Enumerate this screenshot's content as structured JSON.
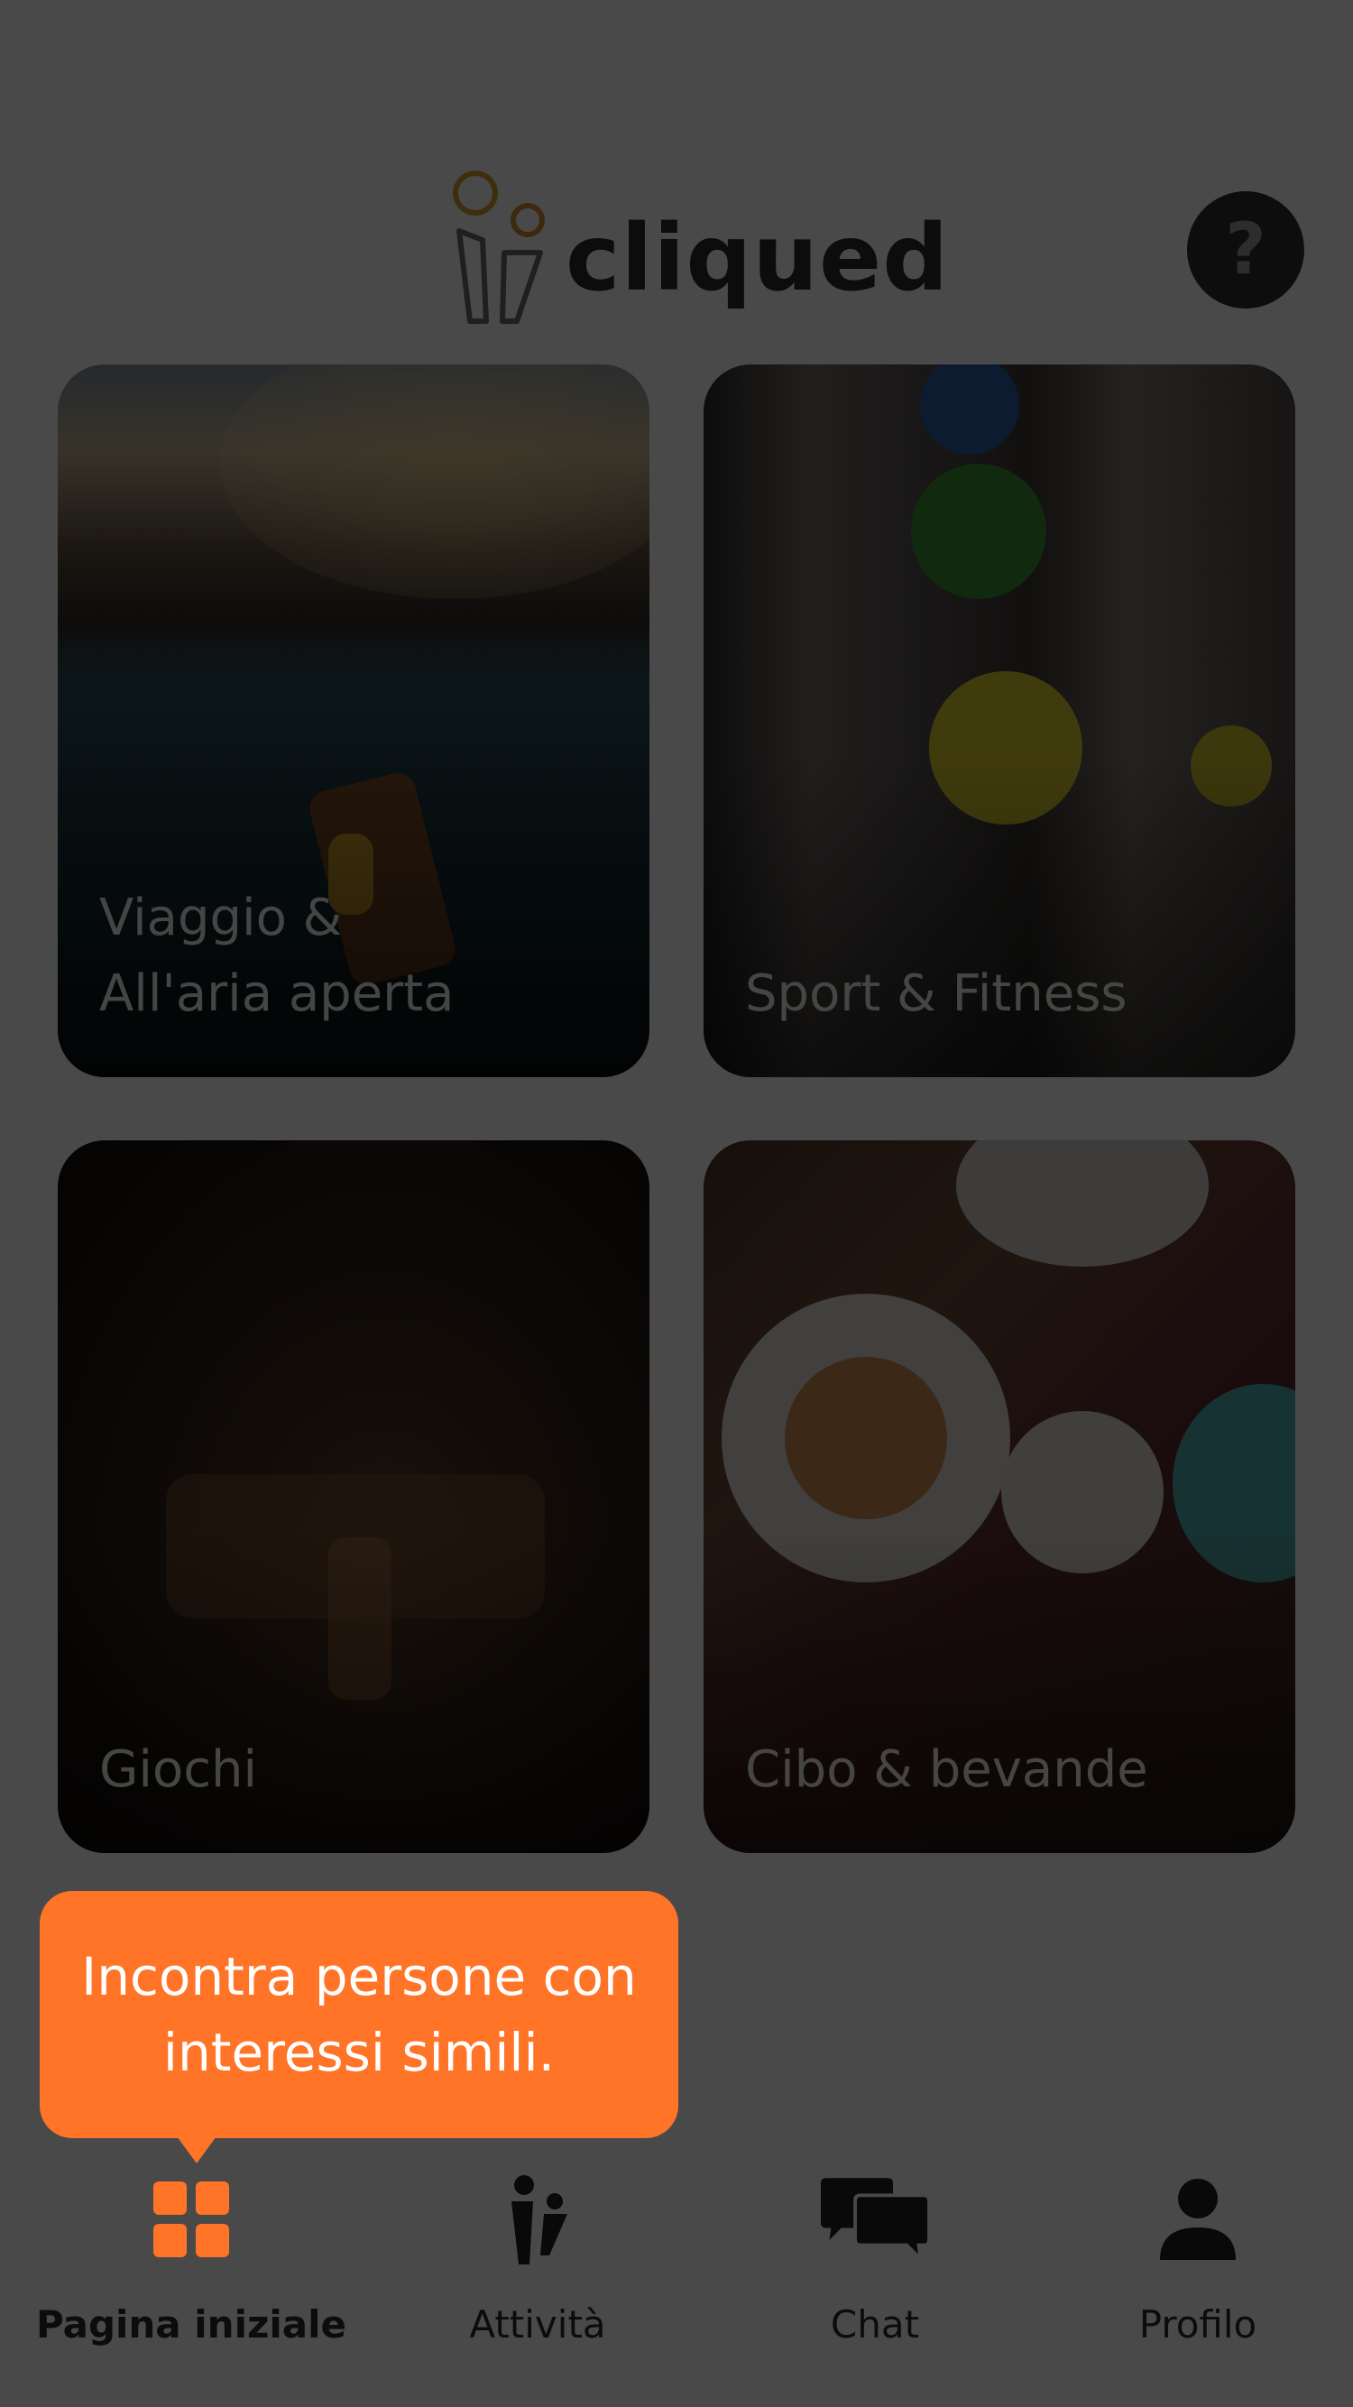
{
  "app": {
    "name": "cliqued"
  },
  "header": {
    "logo_text": "cliqued",
    "help_label": "?"
  },
  "categories": [
    {
      "id": "travel",
      "label_line1": "Viaggio &",
      "label_line2": "All'aria aperta"
    },
    {
      "id": "sport",
      "label": "Sport & Fitness"
    },
    {
      "id": "games",
      "label": "Giochi"
    },
    {
      "id": "food",
      "label": "Cibo & bevande"
    }
  ],
  "tooltip": {
    "text_line1": "Incontra persone con",
    "text_line2": "interessi simili."
  },
  "nav": {
    "items": [
      {
        "label": "Pagina iniziale",
        "icon": "grid-icon",
        "active": true
      },
      {
        "label": "Attività",
        "icon": "people-icon",
        "active": false
      },
      {
        "label": "Chat",
        "icon": "chat-bubbles-icon",
        "active": false
      },
      {
        "label": "Profilo",
        "icon": "person-icon",
        "active": false
      }
    ]
  },
  "colors": {
    "accent": "#ff7426",
    "overlay": "rgba(0,0,0,0.7)",
    "text_dark": "#2a2a2a"
  }
}
